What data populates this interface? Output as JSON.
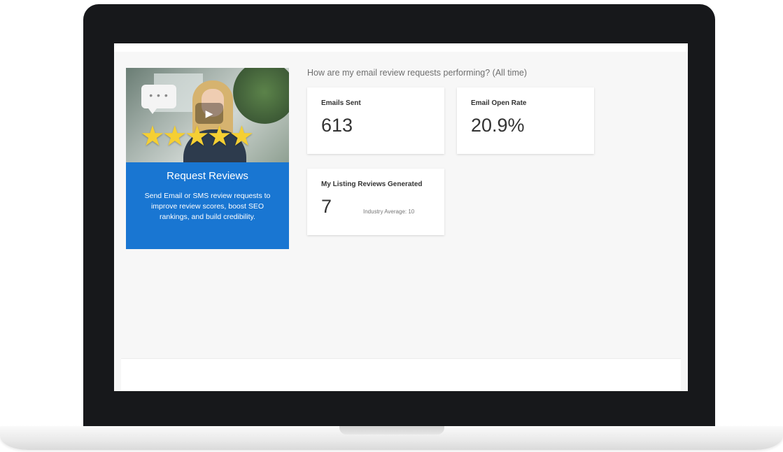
{
  "promo": {
    "bubble_text": "• • •",
    "title": "Request Reviews",
    "description": "Send Email or SMS review requests to improve review scores, boost SEO rankings, and build credibility.",
    "star_icon": "star-icon",
    "star_color": "#f5cf33",
    "background_color": "#1976d2"
  },
  "stats": {
    "heading": "How are my email review requests performing? (All time)",
    "emails_sent": {
      "label": "Emails Sent",
      "value": "613"
    },
    "email_open_rate": {
      "label": "Email Open Rate",
      "value": "20.9%"
    },
    "listing_reviews": {
      "label": "My Listing Reviews Generated",
      "value": "7",
      "industry_average": "Industry Average: 10"
    }
  }
}
